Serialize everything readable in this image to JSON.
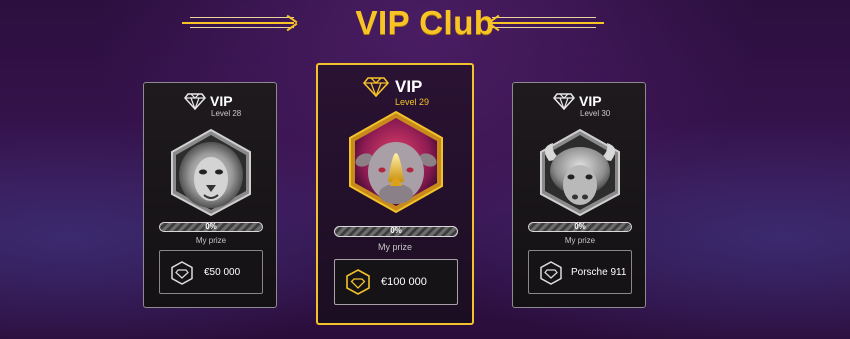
{
  "page": {
    "title": "VIP Club"
  },
  "colors": {
    "accent": "#f2c22a",
    "background": "#2c0f3f"
  },
  "cards": [
    {
      "vip": "VIP",
      "level": "Level 28",
      "animal": "lion",
      "progress_text": "0%",
      "progress": 0,
      "my_prize": "My prize",
      "prize": "€50 000",
      "active": false
    },
    {
      "vip": "VIP",
      "level": "Level 29",
      "animal": "rhino",
      "progress_text": "0%",
      "progress": 0,
      "my_prize": "My prize",
      "prize": "€100 000",
      "active": true
    },
    {
      "vip": "VIP",
      "level": "Level 30",
      "animal": "buffalo",
      "progress_text": "0%",
      "progress": 0,
      "my_prize": "My prize",
      "prize": "Porsche 911",
      "active": false
    }
  ]
}
